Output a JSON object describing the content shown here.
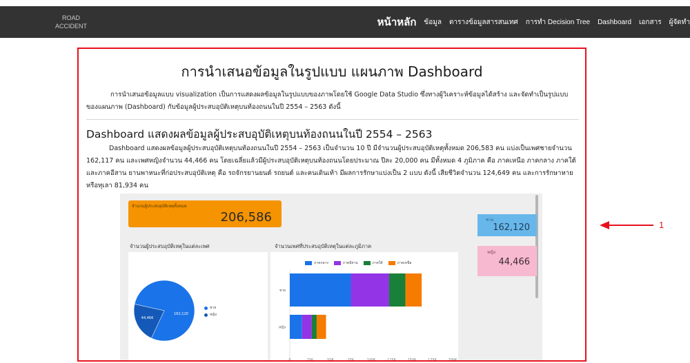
{
  "header": {
    "logo_line1": "ROAD",
    "logo_line2": "ACCIDENT",
    "nav": [
      "หน้าหลัก",
      "ข้อมูล",
      "ตารางข้อมูลสารสนเทศ",
      "การทำ Decision Tree",
      "Dashboard",
      "เอกสาร",
      "ผู้จัดทำ"
    ],
    "active_nav": "หน้าหลัก"
  },
  "content": {
    "title": "การนำเสนอข้อมูลในรูปแบบ แผนภาพ Dashboard",
    "intro": "การนำเสนอข้อมูลแบบ visualization เป็นการแสดงผลข้อมูลในรูปแบบของภาพโดยใช้ Google Data Studio ซึ่งทางผู้วิเคราะห์ข้อมูลได้สร้าง และจัดทำเป็นรูปแบบของแผนภาพ (Dashboard) กับข้อมูลผู้ประสบอุบัติเหตุบนท้องถนนในปี 2554 – 2563 ดังนี้",
    "subtitle": "Dashboard แสดงผลข้อมูลผู้ประสบอุบัติเหตุบนท้องถนนในปี 2554 – 2563",
    "body": "Dashboard แสดงผลข้อมูลผู้ประสบอุบัติเหตุบนท้องถนนในปี 2554 – 2563 เป็นจำนวน 10 ปี มีจำนวนผู้ประสบอุบัติเหตุทั้งหมด 206,583 คน แบ่งเป็นเพศชายจำนวน 162,117 คน และเพศหญิงจำนวน 44,466 คน โดยเฉลี่ยแล้วมีผู้ประสบอุบัติเหตุบนท้องถนนโดยประมาณ ปีละ 20,000 คน มีทั้งหมด 4 ภูมิภาค คือ ภาคเหนือ ภาคกลาง ภาคใต้และภาคอีสาน ยานพาหนะที่ก่อประสบอุบัติเหตุ คือ รถจักรยานยนต์ รถยนต์ และคนเดินเท้า มีผลการรักษาแบ่งเป็น 2 แบบ ดังนี้ เสียชีวิตจำนวน 124,649 คน และการรักษาหายหรือทุเลา 81,934 คน"
  },
  "dashboard": {
    "total_label": "จำนวนผู้ประสบอุบัติเหตุทั้งหมด",
    "total_value": "206,586",
    "male_label": "ชาย",
    "male_value": "162,120",
    "female_label": "หญิง",
    "female_value": "44,466",
    "pie_title": "จำนวนผู้ประสบอุบัติเหตุในแต่ละเพศ",
    "bar_title": "จำนวนเพศที่ประสบอุบัติเหตุในแต่ละภูมิภาค"
  },
  "annotation": {
    "label": "1",
    "color": "#e8101c"
  },
  "colors": {
    "nav_bg": "#333333",
    "orange": "#f59300",
    "blue": "#1a73e8",
    "purple": "#9334e6",
    "green": "#188038",
    "amber": "#f57c00"
  },
  "chart_data": [
    {
      "type": "pie",
      "categories": [
        "ชาย",
        "หญิง"
      ],
      "values": [
        162120,
        44466
      ],
      "data_labels": [
        "162,120",
        "44,466"
      ],
      "colors": [
        "#1a73e8",
        "#1559b8"
      ]
    },
    {
      "type": "bar",
      "orientation": "horizontal",
      "stacked": true,
      "categories": [
        "ชาย",
        "หญิง"
      ],
      "series": [
        {
          "name": "ภาคกลาง",
          "values": [
            75000,
            15000
          ],
          "color": "#1a73e8"
        },
        {
          "name": "ภาคอีสาน",
          "values": [
            47000,
            12000
          ],
          "color": "#9334e6"
        },
        {
          "name": "ภาคใต้",
          "values": [
            20000,
            6000
          ],
          "color": "#188038"
        },
        {
          "name": "ภาคเหนือ",
          "values": [
            20000,
            11500
          ],
          "color": "#f57c00"
        }
      ],
      "xticks": [
        "0",
        "25K",
        "50K",
        "75K",
        "100K",
        "125K",
        "150K",
        "175K",
        "200K"
      ],
      "xlim": [
        0,
        200000
      ]
    }
  ]
}
